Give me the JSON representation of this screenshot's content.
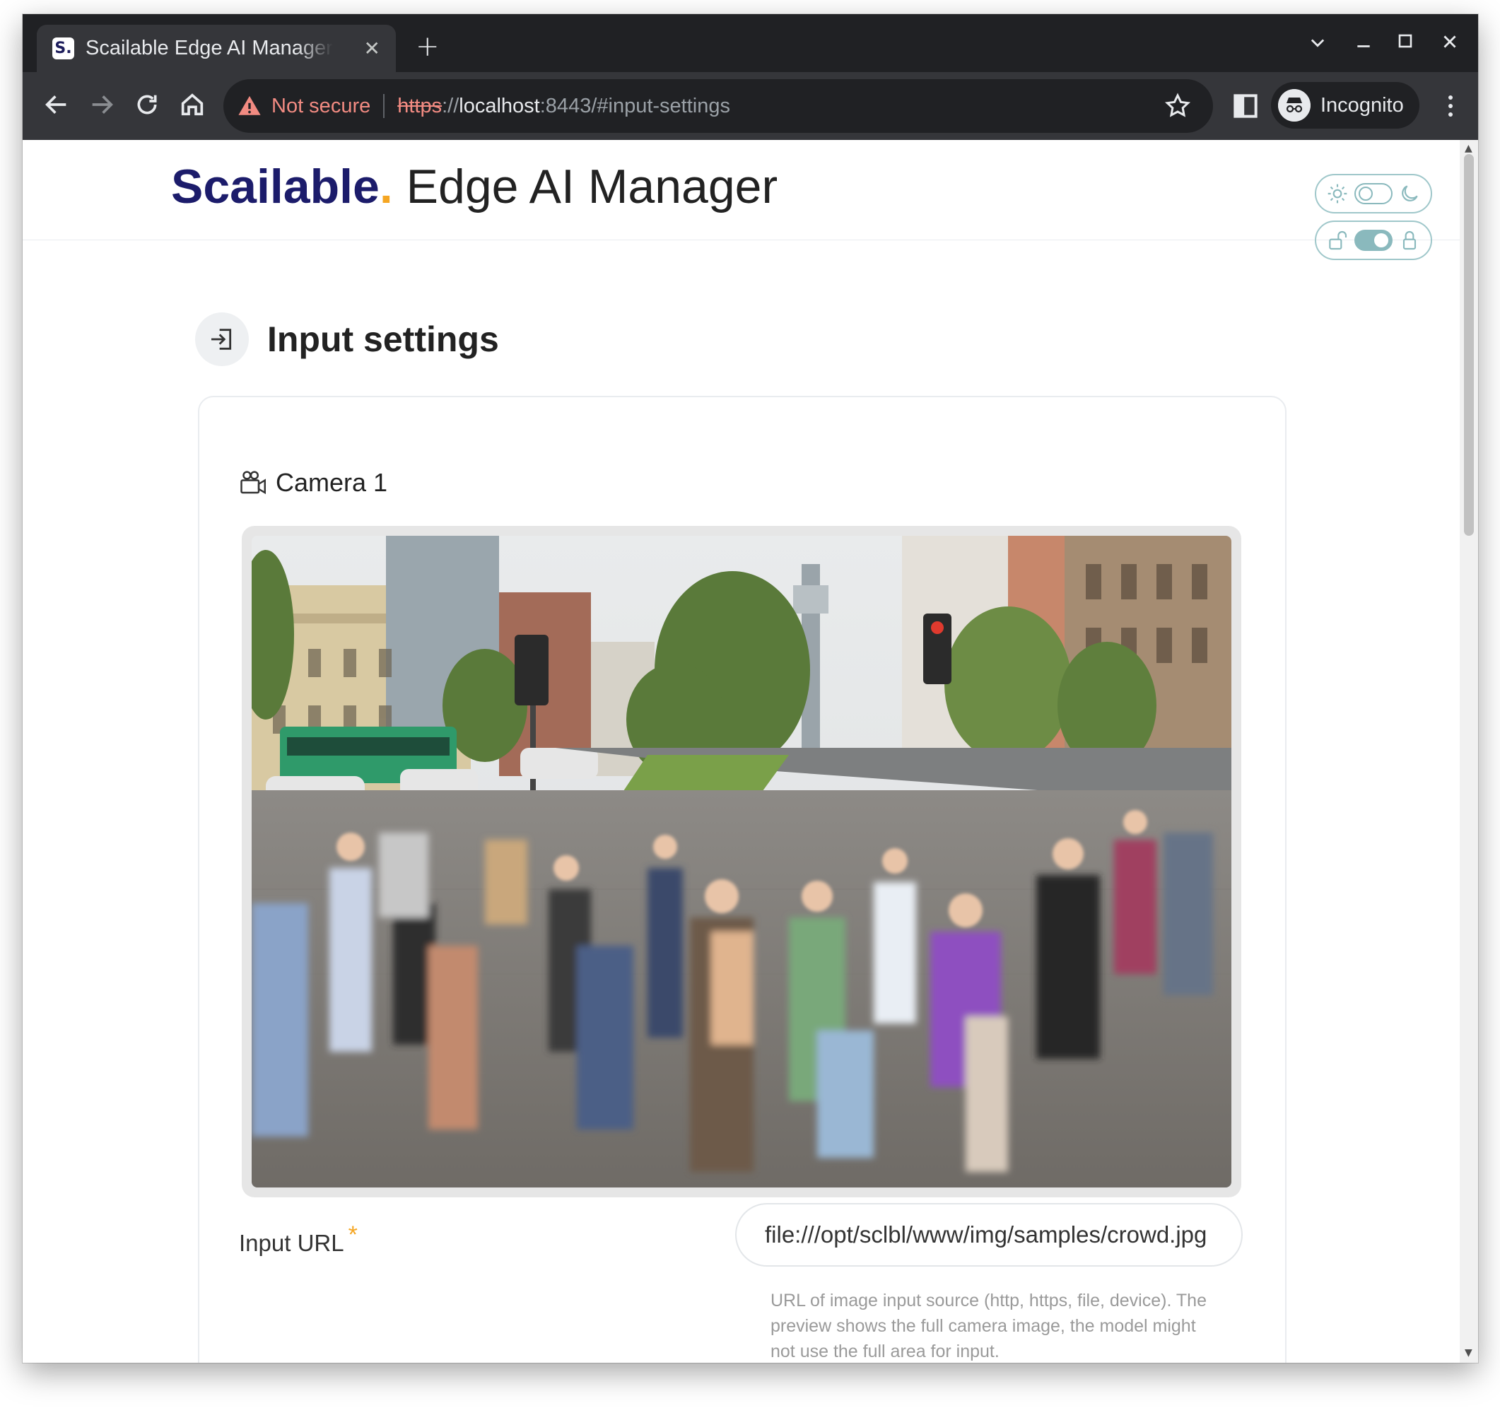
{
  "browser": {
    "tab_title": "Scailable Edge AI Manager",
    "favicon_letter": "S.",
    "not_secure": "Not secure",
    "url_scheme": "https",
    "url_sep": "://",
    "url_host": "localhost",
    "url_rest": ":8443/#input-settings",
    "incognito_label": "Incognito"
  },
  "header": {
    "brand_main": "Scailable",
    "brand_dot": ".",
    "brand_rest": " Edge AI Manager"
  },
  "section": {
    "title": "Input settings"
  },
  "camera": {
    "label": "Camera 1",
    "preview_description": "Busy city crosswalk with motion-blurred pedestrians"
  },
  "input_url": {
    "label": "Input URL",
    "required_mark": "*",
    "value": "file:///opt/sclbl/www/img/samples/crowd.jpg",
    "help": "URL of image input source (http, https, file, device). The preview shows the full camera image, the model might not use the full area for input."
  },
  "toggles": {
    "theme_switch_on": false,
    "lock_switch_on": true
  },
  "colors": {
    "brand_navy": "#1c1c6b",
    "brand_orange": "#f5a623",
    "toggle_teal": "#8ab9bd"
  }
}
